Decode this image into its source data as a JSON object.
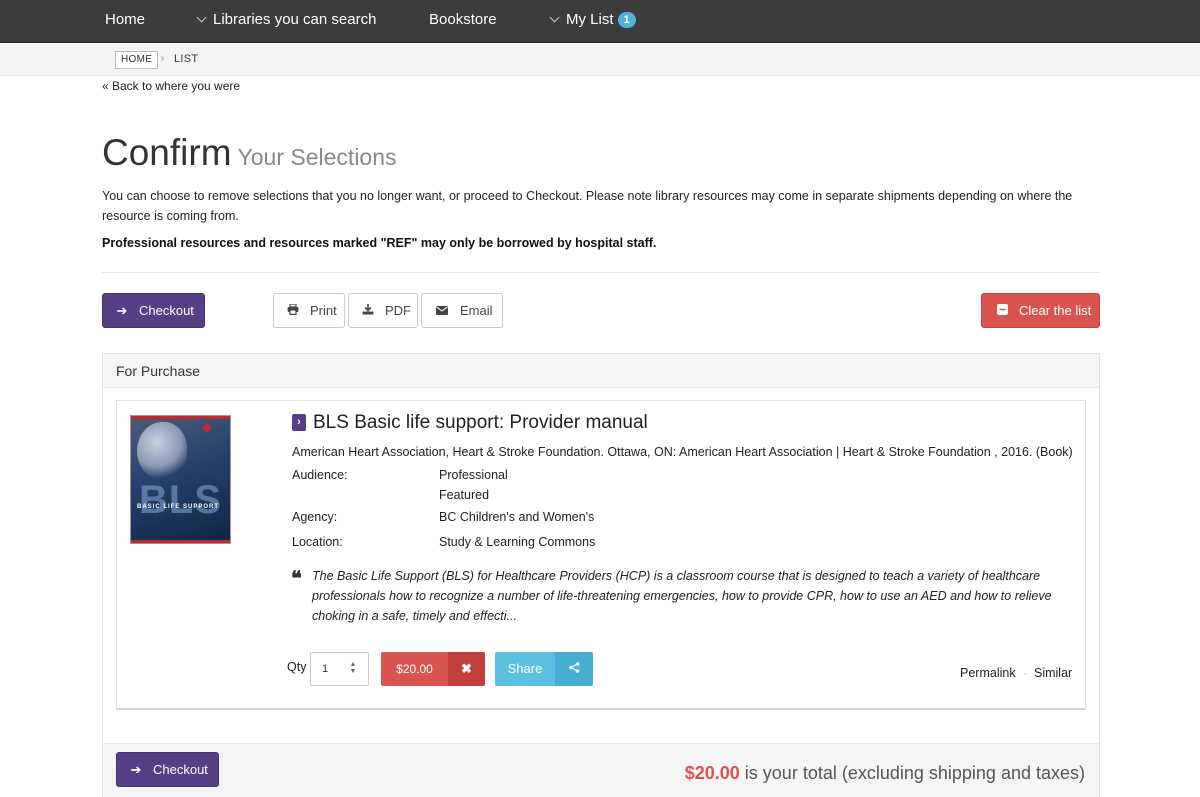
{
  "nav": {
    "home": "Home",
    "libraries": "Libraries you can search",
    "bookstore": "Bookstore",
    "mylist": "My List",
    "mylist_count": "1"
  },
  "breadcrumb": {
    "home": "HOME",
    "separator": "›",
    "current": "LIST"
  },
  "back_link": "« Back to where you were",
  "page": {
    "title": "Confirm",
    "subtitle": "Your Selections",
    "intro": "You can choose to remove selections that you no longer want, or proceed to Checkout. Please note library resources may come in separate shipments depending on where the resource is coming from.",
    "notice": "Professional resources and resources marked \"REF\" may only be borrowed by hospital staff."
  },
  "toolbar": {
    "checkout": "Checkout",
    "print": "Print",
    "pdf": "PDF",
    "email": "Email",
    "clear": "Clear the list"
  },
  "panel": {
    "heading": "For Purchase",
    "record": {
      "cover_text": "BLS",
      "cover_label": "BASIC LIFE SUPPORT",
      "title": "BLS Basic life support: Provider manual",
      "meta": "American Heart Association, Heart & Stroke Foundation. Ottawa, ON: American Heart Association | Heart & Stroke Foundation , 2016. (Book)",
      "audience_label": "Audience:",
      "audience_values": [
        "Professional",
        "Featured"
      ],
      "agency_label": "Agency:",
      "agency_value": "BC Children's and Women's",
      "location_label": "Location:",
      "location_value": "Study & Learning Commons",
      "summary": "The Basic Life Support (BLS) for Healthcare Providers (HCP) is a classroom course that is designed to teach a variety of healthcare professionals how to recognize a number of life-threatening emergencies, how to provide CPR, how to use an AED and how to relieve choking in a safe, timely and effecti...",
      "qty_label": "Qty",
      "qty_value": "1",
      "price": "$20.00",
      "share": "Share",
      "permalink": "Permalink",
      "similar": "Similar"
    },
    "footer": {
      "checkout": "Checkout",
      "total_amount": "$20.00",
      "total_text": " is your total (excluding shipping and taxes)"
    }
  },
  "colors": {
    "nav_bg": "#3c3c3c",
    "primary": "#553f86",
    "danger": "#d9534f",
    "info": "#5bc0de",
    "badge": "#4fb3d9"
  },
  "icons": {
    "checkout": "arrow-right-icon",
    "print": "printer-icon",
    "pdf": "download-icon",
    "email": "envelope-icon",
    "clear": "minus-square-icon",
    "remove": "close-icon",
    "share": "share-icon",
    "quote": "quote-icon"
  }
}
